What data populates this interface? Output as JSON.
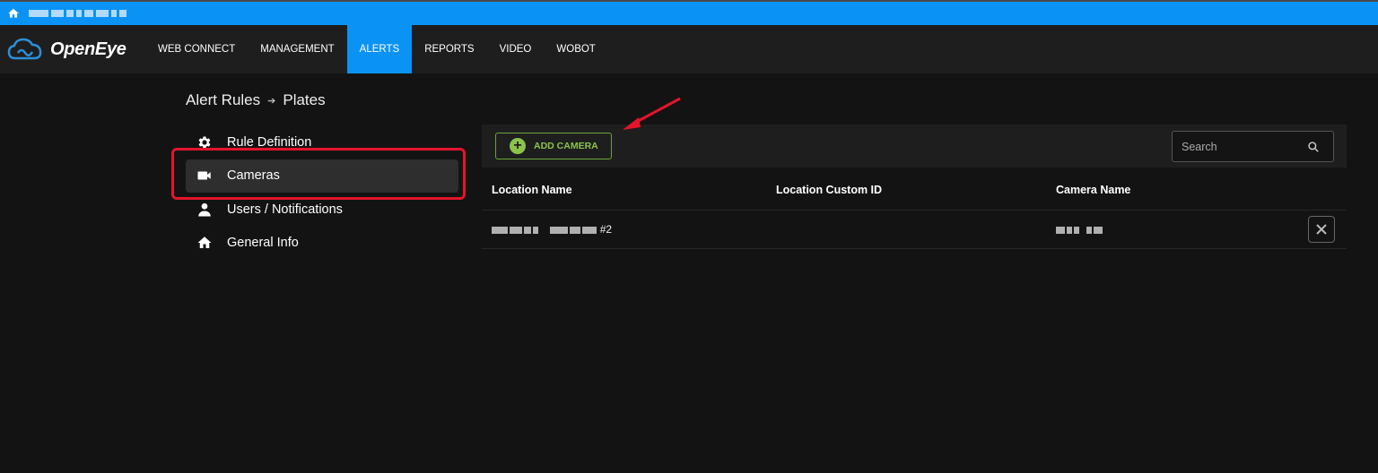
{
  "nav": {
    "brand": "OpenEye",
    "items": [
      {
        "label": "WEB CONNECT",
        "active": false
      },
      {
        "label": "MANAGEMENT",
        "active": false
      },
      {
        "label": "ALERTS",
        "active": true
      },
      {
        "label": "REPORTS",
        "active": false
      },
      {
        "label": "VIDEO",
        "active": false
      },
      {
        "label": "WOBOT",
        "active": false
      }
    ]
  },
  "breadcrumb": {
    "parent": "Alert Rules",
    "current": "Plates"
  },
  "sidebar": {
    "items": [
      {
        "label": "Rule Definition",
        "icon": "gear-icon"
      },
      {
        "label": "Cameras",
        "icon": "video-camera-icon",
        "active": true
      },
      {
        "label": "Users / Notifications",
        "icon": "user-icon"
      },
      {
        "label": "General Info",
        "icon": "home-icon"
      }
    ]
  },
  "toolbar": {
    "add_label": "ADD CAMERA",
    "search_placeholder": "Search"
  },
  "table": {
    "headers": [
      "Location Name",
      "Location Custom ID",
      "Camera Name"
    ],
    "rows": [
      {
        "location_suffix": "#2",
        "custom_id": ""
      }
    ]
  },
  "colors": {
    "accent": "#0a93f5",
    "add_green": "#8bc34a",
    "highlight_red": "#e4142c"
  }
}
